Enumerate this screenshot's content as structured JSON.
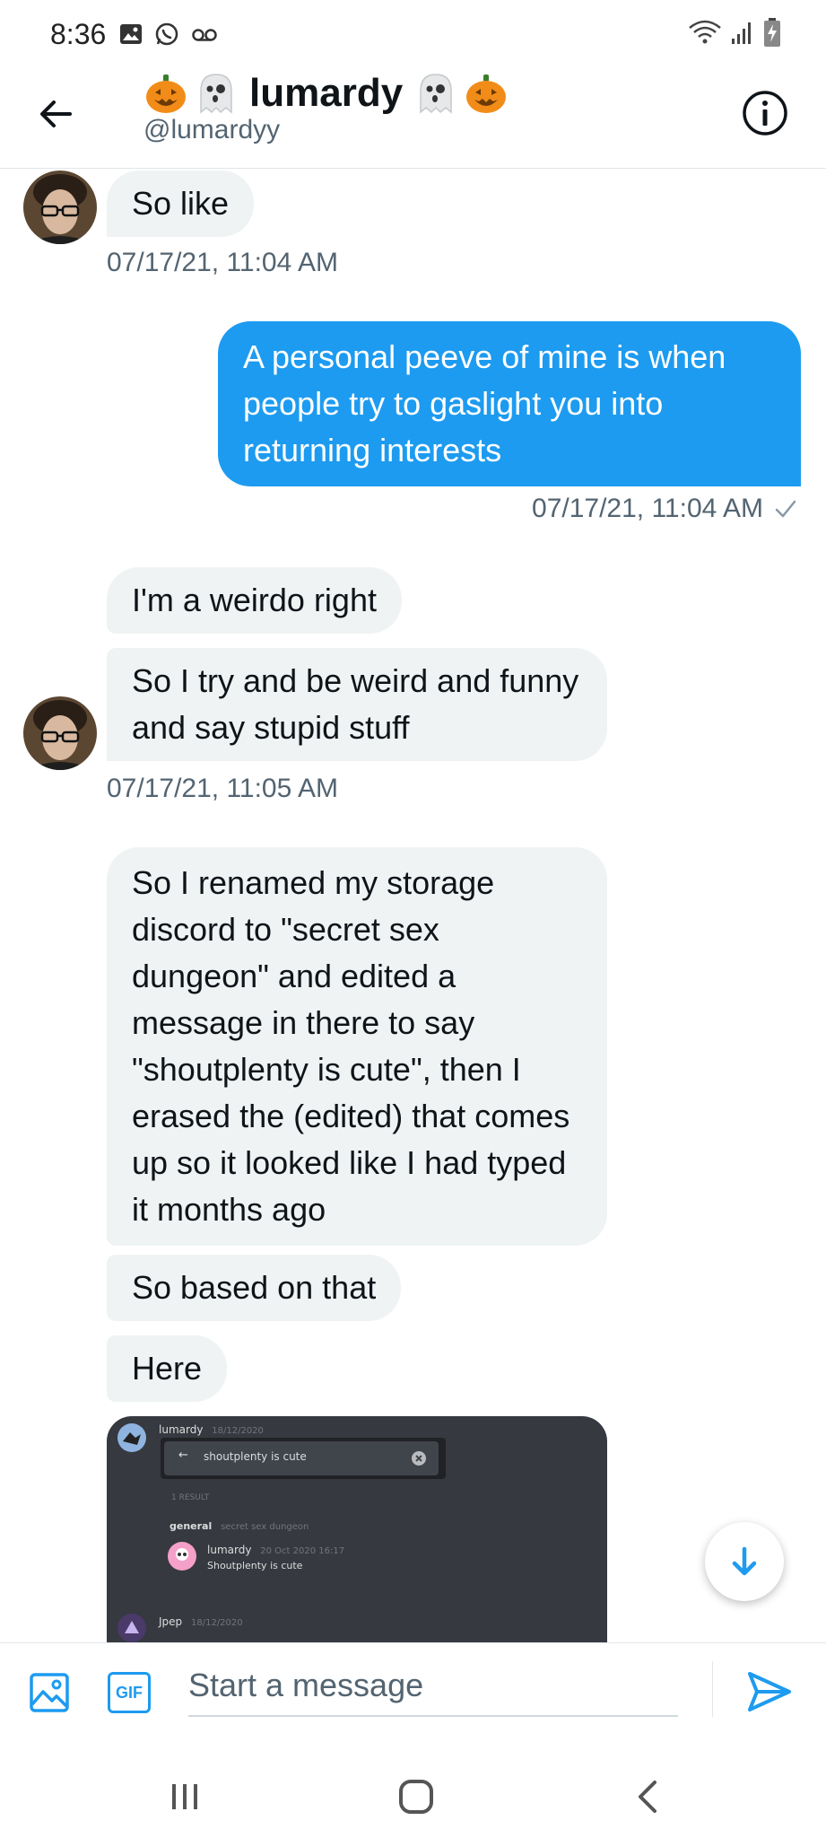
{
  "status_bar": {
    "time": "8:36",
    "left_icons": [
      "image-icon",
      "whatsapp-icon",
      "voicemail-icon"
    ],
    "right_icons": [
      "wifi-icon",
      "signal-icon",
      "battery-charging-icon"
    ]
  },
  "header": {
    "display_name": "lumardy",
    "name_emojis": [
      "jack-o-lantern",
      "ghost",
      "ghost",
      "jack-o-lantern"
    ],
    "handle": "@lumardyy"
  },
  "messages": [
    {
      "direction": "in",
      "text": "So like",
      "timestamp": "07/17/21, 11:04 AM"
    },
    {
      "direction": "out",
      "text": "A personal peeve of mine is when people try to gaslight you into returning interests",
      "timestamp": "07/17/21, 11:04 AM",
      "status": "sent"
    },
    {
      "direction": "in",
      "text": "I'm a weirdo right"
    },
    {
      "direction": "in",
      "text": "So I try and be weird and funny and say stupid stuff",
      "timestamp": "07/17/21, 11:05 AM"
    },
    {
      "direction": "in",
      "text": "So I renamed my storage discord to \"secret sex dungeon\" and edited a message in there to say \"shoutplenty is cute\", then I erased the (edited) that comes up so it looked like I had typed it months ago"
    },
    {
      "direction": "in",
      "text": "So based on that"
    },
    {
      "direction": "in",
      "text": "Here"
    }
  ],
  "attachment": {
    "user1": "lumardy",
    "user1_date": "18/12/2020",
    "search_text": "shoutplenty is cute",
    "result_label": "1 RESULT",
    "channel": "general",
    "channel_server": "secret sex dungeon",
    "result_user": "lumardy",
    "result_date": "20 Oct 2020 16:17",
    "result_text": "Shoutplenty is cute",
    "user2": "Jpep",
    "user2_date": "18/12/2020"
  },
  "compose": {
    "placeholder": "Start a message",
    "gif_label": "GIF"
  },
  "colors": {
    "accent": "#1d9bf0",
    "incoming_bubble": "#eff3f4",
    "muted_text": "#536471",
    "discord_bg": "#36393f"
  }
}
